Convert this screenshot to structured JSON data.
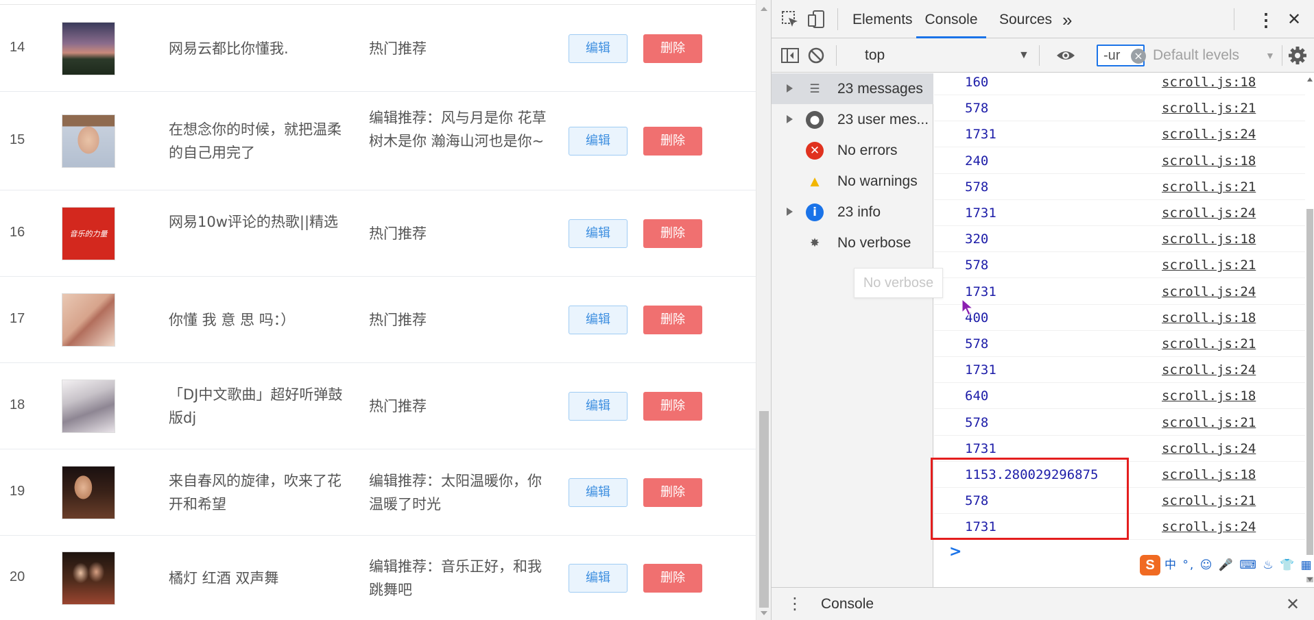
{
  "playlist": {
    "rows": [
      {
        "index": "14",
        "title": "网易云都比你懂我.",
        "tag": "热门推荐",
        "edit": "编辑",
        "delete": "删除"
      },
      {
        "index": "15",
        "title": "在想念你的时候，就把温柔的自己用完了",
        "tag": "编辑推荐：风与月是你 花草树木是你 瀚海山河也是你~",
        "edit": "编辑",
        "delete": "删除"
      },
      {
        "index": "16",
        "title": "网易10w评论的热歌||精选",
        "tag": "热门推荐",
        "edit": "编辑",
        "delete": "删除",
        "thumb_text": "音乐的力量"
      },
      {
        "index": "17",
        "title": "你懂 我 意 思 吗：）",
        "tag": "热门推荐",
        "edit": "编辑",
        "delete": "删除"
      },
      {
        "index": "18",
        "title": "「DJ中文歌曲」超好听弹鼓版dj",
        "tag": "热门推荐",
        "edit": "编辑",
        "delete": "删除"
      },
      {
        "index": "19",
        "title": "来自春风的旋律，吹来了花开和希望",
        "tag": "编辑推荐：太阳温暖你，你温暖了时光",
        "edit": "编辑",
        "delete": "删除"
      },
      {
        "index": "20",
        "title": "橘灯 红酒 双声舞",
        "tag": "编辑推荐：音乐正好，和我跳舞吧",
        "edit": "编辑",
        "delete": "删除"
      }
    ]
  },
  "devtools": {
    "tabs": [
      "Elements",
      "Console",
      "Sources"
    ],
    "active_tab": "Console",
    "more_tabs": "»",
    "menu_glyph": "⋮",
    "close_glyph": "✕",
    "context": "top",
    "filter_value": "-ur",
    "levels": "Default levels",
    "sidebar": [
      {
        "label": "23 messages",
        "icon": "list-icon",
        "expandable": true
      },
      {
        "label": "23 user mes...",
        "icon": "user-icon",
        "expandable": true
      },
      {
        "label": "No errors",
        "icon": "error-icon",
        "expandable": false
      },
      {
        "label": "No warnings",
        "icon": "warning-icon",
        "expandable": false
      },
      {
        "label": "23 info",
        "icon": "info-icon",
        "expandable": true
      },
      {
        "label": "No verbose",
        "icon": "bug-icon",
        "expandable": false
      }
    ],
    "tooltip": "No verbose",
    "messages": [
      {
        "value": "160",
        "source": "scroll.js:18"
      },
      {
        "value": "578",
        "source": "scroll.js:21"
      },
      {
        "value": "1731",
        "source": "scroll.js:24"
      },
      {
        "value": "240",
        "source": "scroll.js:18"
      },
      {
        "value": "578",
        "source": "scroll.js:21"
      },
      {
        "value": "1731",
        "source": "scroll.js:24"
      },
      {
        "value": "320",
        "source": "scroll.js:18"
      },
      {
        "value": "578",
        "source": "scroll.js:21"
      },
      {
        "value": "1731",
        "source": "scroll.js:24"
      },
      {
        "value": "400",
        "source": "scroll.js:18"
      },
      {
        "value": "578",
        "source": "scroll.js:21"
      },
      {
        "value": "1731",
        "source": "scroll.js:24"
      },
      {
        "value": "640",
        "source": "scroll.js:18"
      },
      {
        "value": "578",
        "source": "scroll.js:21"
      },
      {
        "value": "1731",
        "source": "scroll.js:24"
      },
      {
        "value": "1153.280029296875",
        "source": "scroll.js:18"
      },
      {
        "value": "578",
        "source": "scroll.js:21"
      },
      {
        "value": "1731",
        "source": "scroll.js:24"
      }
    ],
    "prompt": ">",
    "drawer_title": "Console",
    "drawer_menu": "⋮",
    "drawer_close": "✕",
    "ime_logo": "S",
    "ime_glyphs": "中 °, ☺ 🎤 ⌨ ♨ 👕 ▦"
  },
  "colors": {
    "accent": "#1a73e8",
    "delete_button": "#f07070",
    "edit_button_text": "#3e8fe0",
    "highlight": "#e41e1e"
  }
}
